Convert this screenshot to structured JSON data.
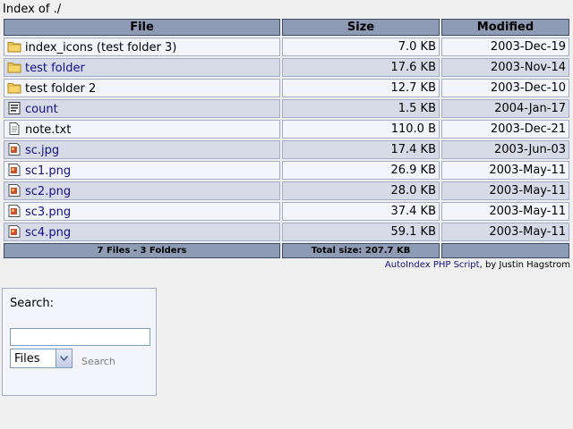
{
  "heading": {
    "prefix": "Index of ",
    "path": "./"
  },
  "columns": {
    "file": "File",
    "size": "Size",
    "modified": "Modified"
  },
  "rows": [
    {
      "name": "index_icons (test folder 3)",
      "size": "7.0 KB",
      "modified": "2003-Dec-19",
      "icon": "folder-icon"
    },
    {
      "name": "test folder",
      "size": "17.6 KB",
      "modified": "2003-Nov-14",
      "icon": "folder-icon"
    },
    {
      "name": "test folder 2",
      "size": "12.7 KB",
      "modified": "2003-Dec-10",
      "icon": "folder-icon"
    },
    {
      "name": "count",
      "size": "1.5 KB",
      "modified": "2004-Jan-17",
      "icon": "script-file-icon"
    },
    {
      "name": "note.txt",
      "size": "110.0 B",
      "modified": "2003-Dec-21",
      "icon": "text-file-icon"
    },
    {
      "name": "sc.jpg",
      "size": "17.4 KB",
      "modified": "2003-Jun-03",
      "icon": "image-file-icon"
    },
    {
      "name": "sc1.png",
      "size": "26.9 KB",
      "modified": "2003-May-11",
      "icon": "image-file-icon"
    },
    {
      "name": "sc2.png",
      "size": "28.0 KB",
      "modified": "2003-May-11",
      "icon": "image-file-icon"
    },
    {
      "name": "sc3.png",
      "size": "37.4 KB",
      "modified": "2003-May-11",
      "icon": "image-file-icon"
    },
    {
      "name": "sc4.png",
      "size": "59.1 KB",
      "modified": "2003-May-11",
      "icon": "image-file-icon"
    }
  ],
  "footer": {
    "counts": "7 Files - 3 Folders",
    "total": "Total size: 207.7 KB",
    "modified": ""
  },
  "credits": {
    "link_text": "AutoIndex PHP Script",
    "by": ", by Justin Hagstrom"
  },
  "search": {
    "label": "Search:",
    "input_value": "",
    "select_value": "Files",
    "button_label": "Search"
  },
  "colors": {
    "header_bg": "#8e9bb5",
    "row_odd": "#f3f5fb",
    "row_even": "#d7dbe8",
    "link": "#0f0f86"
  }
}
